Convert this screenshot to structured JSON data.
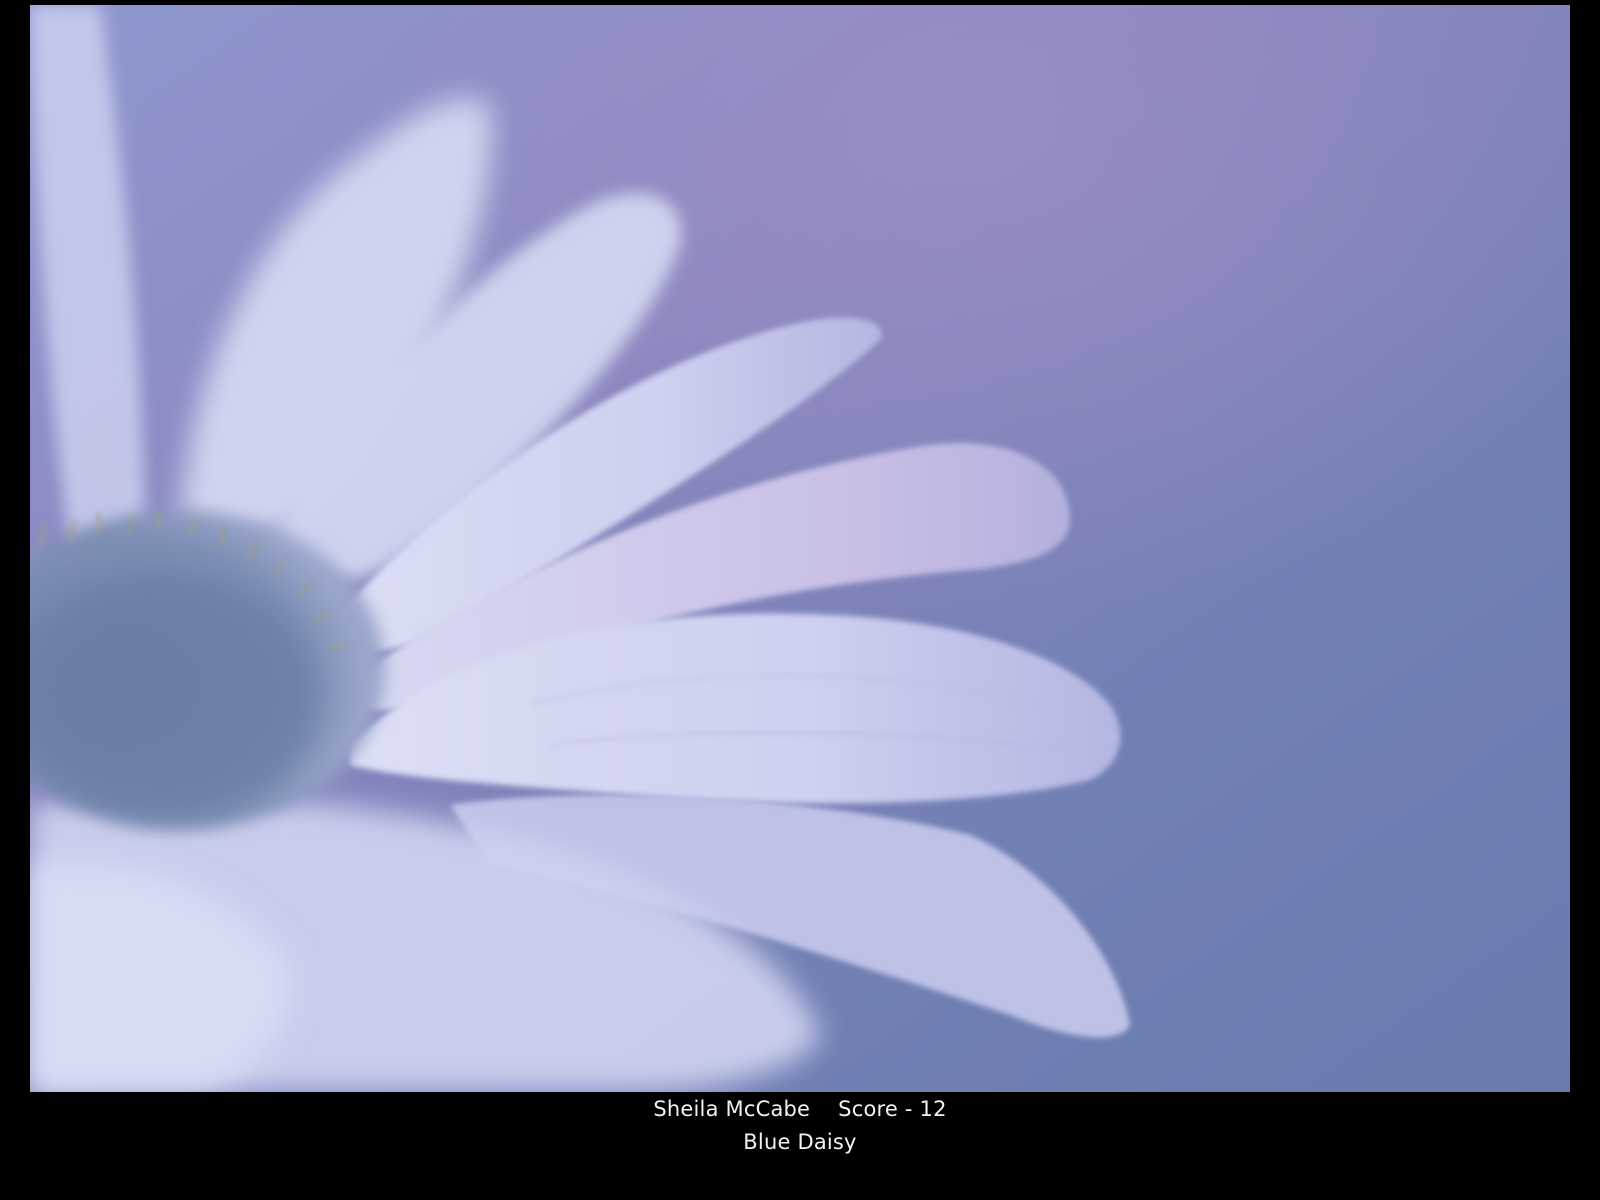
{
  "photo": {
    "subject": "daisy-photograph",
    "colors": {
      "background_top": "#8f99cf",
      "background_mid": "#8a87bf",
      "background_bottom": "#6b7bae",
      "petal_light": "#dcdff5",
      "petal_shadow": "#b4b6e2",
      "petal_lavender": "#c9bfe6",
      "center_disc": "#6f82a8",
      "stamen": "#a0a07a"
    }
  },
  "caption": {
    "author": "Sheila McCabe",
    "score": "Score - 12",
    "title": "Blue Daisy"
  }
}
